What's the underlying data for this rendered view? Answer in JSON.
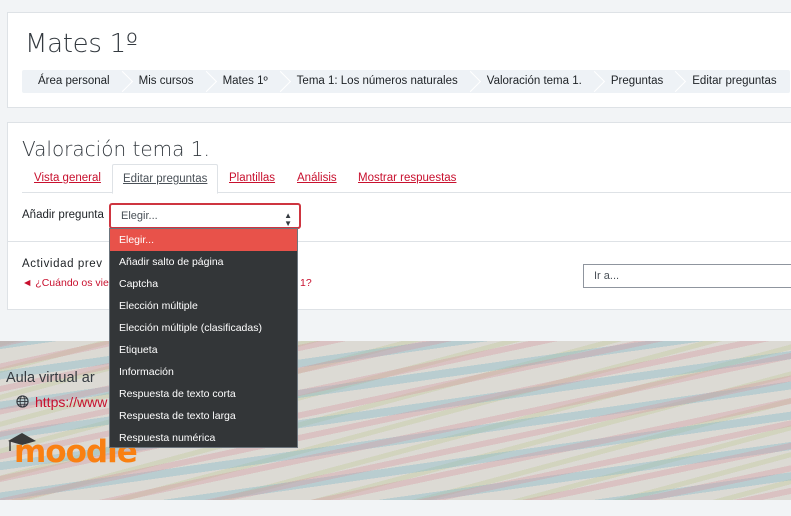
{
  "header": {
    "course_title": "Mates 1º",
    "breadcrumb": [
      "Área personal",
      "Mis cursos",
      "Mates 1º",
      "Tema 1: Los números naturales",
      "Valoración tema 1.",
      "Preguntas",
      "Editar preguntas"
    ]
  },
  "main": {
    "activity_title": "Valoración tema 1.",
    "tabs": [
      {
        "label": "Vista general"
      },
      {
        "label": "Editar preguntas"
      },
      {
        "label": "Plantillas"
      },
      {
        "label": "Análisis"
      },
      {
        "label": "Mostrar respuestas"
      }
    ],
    "add_question_label": "Añadir pregunta",
    "select_value": "Elegir...",
    "previous_activity_label": "Actividad prev",
    "previous_link_text": "◄ ¿Cuándo os vie",
    "previous_link_end": "1?",
    "goto_select_value": "Ir a..."
  },
  "dropdown": {
    "options": [
      "Elegir...",
      "Añadir salto de página",
      "Captcha",
      "Elección múltiple",
      "Elección múltiple (clasificadas)",
      "Etiqueta",
      "Información",
      "Respuesta de texto corta",
      "Respuesta de texto larga",
      "Respuesta numérica"
    ],
    "selected_index": 0
  },
  "footer": {
    "site_text": "Aula virtual ar",
    "link_text": "https://www",
    "logo_text": "moodle"
  },
  "colors": {
    "accent": "#c8102e",
    "highlight_option": "#e8524a",
    "select_border": "#ce3540",
    "dropdown_bg": "#333638",
    "logo_orange": "#f98012"
  },
  "icons": [
    "globe-icon",
    "chevron-updown-icon",
    "moodle-hat-icon"
  ]
}
